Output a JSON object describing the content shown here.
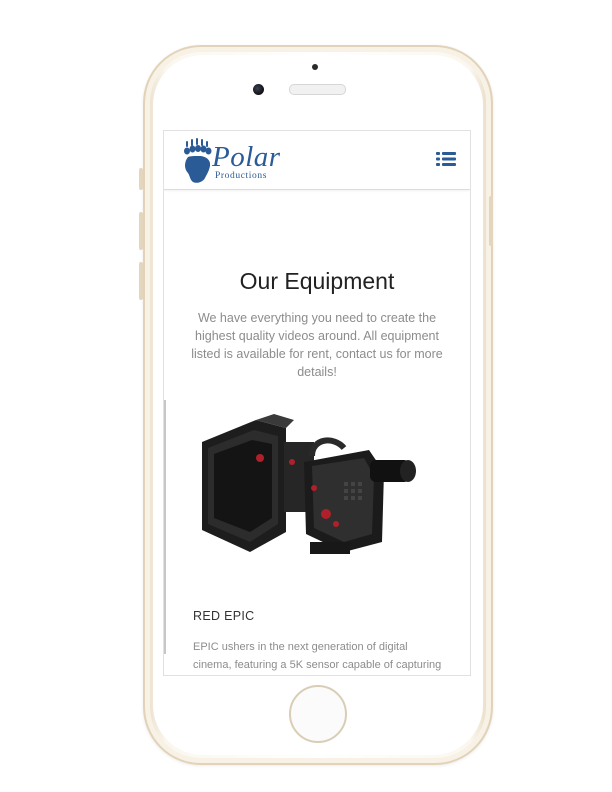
{
  "brand": {
    "name": "Polar",
    "tagline": "Productions",
    "color": "#2a5b96"
  },
  "navbar": {
    "menu_icon": "list-icon"
  },
  "main": {
    "title": "Our Equipment",
    "intro": "We have everything you need to create the highest quality videos around. All equipment listed is available for rent, contact us for more details!"
  },
  "product": {
    "name": "RED EPIC",
    "description": "EPIC ushers in the next generation of digital cinema, featuring a 5K sensor capable of capturing stunning footage at full resolution"
  }
}
